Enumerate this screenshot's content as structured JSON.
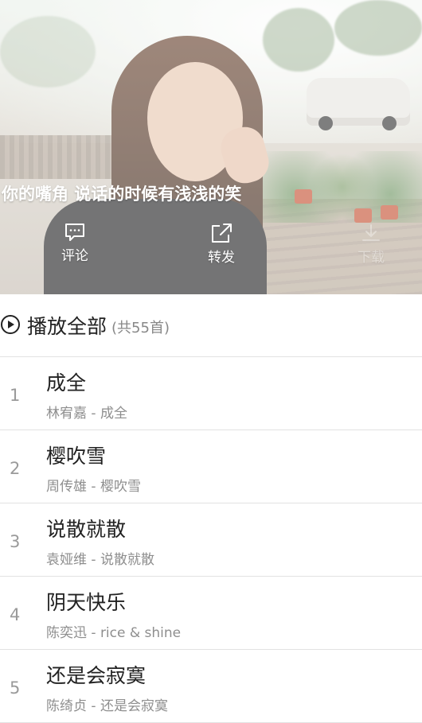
{
  "hero": {
    "caption": "你的嘴角 说话的时候有浅浅的笑",
    "actions": [
      {
        "label": "评论",
        "icon": "comment-icon"
      },
      {
        "label": "转发",
        "icon": "share-icon"
      },
      {
        "label": "下载",
        "icon": "download-icon"
      }
    ]
  },
  "playlist": {
    "play_all_label": "播放全部",
    "count_label": "(共55首)"
  },
  "songs": [
    {
      "index": "1",
      "title": "成全",
      "subtitle": "林宥嘉 - 成全"
    },
    {
      "index": "2",
      "title": "樱吹雪",
      "subtitle": "周传雄 - 樱吹雪"
    },
    {
      "index": "3",
      "title": "说散就散",
      "subtitle": "袁娅维 - 说散就散"
    },
    {
      "index": "4",
      "title": "阴天快乐",
      "subtitle": "陈奕迅 - rice & shine"
    },
    {
      "index": "5",
      "title": "还是会寂寞",
      "subtitle": "陈绮贞 - 还是会寂寞"
    }
  ]
}
